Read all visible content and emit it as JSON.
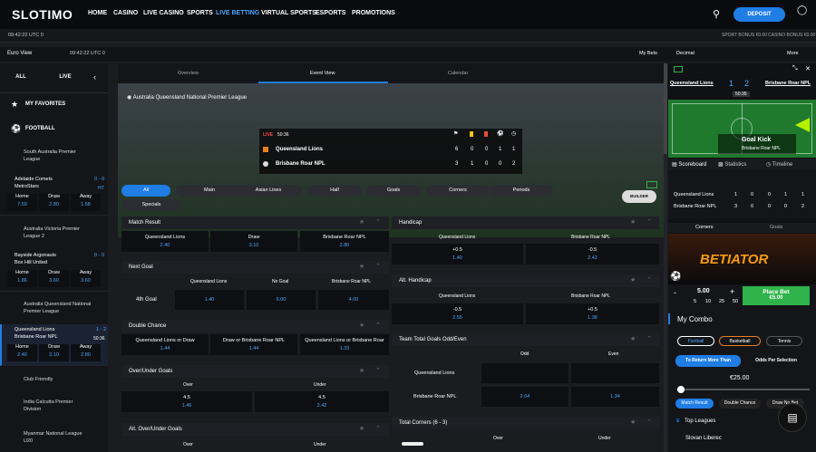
{
  "nav": {
    "logo": "SLOTIMO",
    "items": [
      "HOME",
      "CASINO",
      "LIVE CASINO",
      "SPORTS",
      "LIVE BETTING",
      "VIRTUAL SPORTS",
      "ESPORTS",
      "PROMOTIONS"
    ],
    "deposit": "DEPOSIT",
    "active_color": "#4aa8ff"
  },
  "timebar": {
    "time": "09:42:22 UTC 0",
    "bonus1": "SPORT BONUS €0.00",
    "bonus2": "CASINO BONUS €0.00"
  },
  "toolbar": {
    "view": "Euro View",
    "time": "09:42:22 UTC 0",
    "mybets": "My Bets",
    "decimal": "Decimal",
    "more": "More"
  },
  "left": {
    "tab_all": "ALL",
    "tab_live": "LIVE",
    "favorites": "MY FAVORITES",
    "football": "FOOTBALL",
    "leagues": [
      {
        "name": "South Australia Premier League"
      },
      {
        "name": "Australia Victoria Premier League 2"
      },
      {
        "name": "Australia Queensland National Premier League"
      },
      {
        "name": "Club Friendly"
      },
      {
        "name": "India Calcutta Premier Division"
      },
      {
        "name": "Myanmar National League U20"
      }
    ],
    "matches": [
      {
        "home": "Adelaide Comets",
        "away": "MetroStars",
        "score": "0 - 0",
        "time": "HT",
        "h": "7.50",
        "d": "2.80",
        "a": "1.58"
      },
      {
        "home": "Bayside Argonauts",
        "away": "Box Hill United",
        "score": "0 - 0",
        "time": "",
        "h": "1.86",
        "d": "3.60",
        "a": "3.60"
      },
      {
        "home": "Queensland Lions",
        "away": "Brisbane Roar NPL",
        "score": "1 - 2",
        "time": "50:36",
        "h": "2.40",
        "d": "3.10",
        "a": "2.80"
      }
    ],
    "lbl_home": "Home",
    "lbl_draw": "Draw",
    "lbl_away": "Away"
  },
  "center": {
    "tabs": [
      "Overview",
      "Event View",
      "Calendar"
    ],
    "league": "Australia Queensland National Premier League",
    "live": "LIVE",
    "clock": "50:36",
    "team1": {
      "name": "Queensland Lions",
      "stats": [
        "6",
        "0",
        "0",
        "1",
        "1"
      ]
    },
    "team2": {
      "name": "Brisbane Roar NPL",
      "stats": [
        "3",
        "1",
        "0",
        "0",
        "2"
      ]
    },
    "pills": [
      "All",
      "Main",
      "Asian Lines",
      "Half",
      "Goals",
      "Corners",
      "Periods",
      "Specials"
    ],
    "builder": "BUILDER",
    "match_result": {
      "title": "Match Result",
      "opts": [
        {
          "l": "Queensland Lions",
          "o": "2.40"
        },
        {
          "l": "Draw",
          "o": "3.10"
        },
        {
          "l": "Brisbane Roar NPL",
          "o": "2.80"
        }
      ]
    },
    "next_goal": {
      "title": "Next Goal",
      "h1": "Queensland Lions",
      "h2": "No Goal",
      "h3": "Brisbane Roar NPL",
      "row": "4th Goal",
      "o": [
        "1.40",
        "6.00",
        "4.00"
      ]
    },
    "double_chance": {
      "title": "Double Chance",
      "opts": [
        {
          "l": "Queensland Lions or Draw",
          "o": "1.44"
        },
        {
          "l": "Draw or Brisbane Roar NPL",
          "o": "1.44"
        },
        {
          "l": "Queensland Lions or Brisbane Roar",
          "o": "1.33"
        }
      ]
    },
    "ou": {
      "title": "Over/Under Goals",
      "over": "Over",
      "under": "Under",
      "l1": "4.5",
      "o1": "1.46",
      "l2": "4.5",
      "o2": "2.42"
    },
    "alt_ou": {
      "title": "Alt. Over/Under Goals",
      "over": "Over",
      "under": "Under"
    },
    "handicap": {
      "title": "Handicap",
      "h1": "Queensland Lions",
      "h2": "Brisbane Roar NPL",
      "l1": "+0.5",
      "o1": "1.40",
      "l2": "-0.5",
      "o2": "2.42"
    },
    "alt_handicap": {
      "title": "Alt. Handicap",
      "h1": "Queensland Lions",
      "h2": "Brisbane Roar NPL",
      "l1": "-0.5",
      "o1": "2.55",
      "l2": "+0.5",
      "o2": "1.38"
    },
    "ttg": {
      "title": "Team Total Goals Odd/Even",
      "odd": "Odd",
      "even": "Even",
      "t1": "Queensland Lions",
      "t2": "Brisbane Roar NPL",
      "o1": "2.64",
      "o2": "1.34"
    },
    "corners": {
      "title": "Total Corners",
      "range": "(6 - 3)",
      "over": "Over",
      "under": "Under"
    }
  },
  "right": {
    "team1": "Queensland Lions",
    "team2": "Brisbane Roar NPL",
    "s1": "1",
    "s2": "2",
    "clock": "50:35",
    "event": "Goal Kick",
    "event_team": "Brisbane Roar NPL",
    "tabs": [
      "Scoreboard",
      "Statistics",
      "Timeline"
    ],
    "stats": [
      {
        "n": "Queensland Lions",
        "v": [
          "1",
          "0",
          "0",
          "1",
          "1"
        ]
      },
      {
        "n": "Brisbane Roar NPL",
        "v": [
          "3",
          "0",
          "0",
          "0",
          "2"
        ]
      }
    ],
    "corners": "Corners",
    "goals": "Goals",
    "ad": "BETIATOR",
    "stake": "5.00",
    "minus": "-",
    "plus": "+",
    "chips": [
      "5",
      "10",
      "25",
      "50"
    ],
    "place": "Place Bet",
    "place_amt": "€5.00",
    "mycombo": "My Combo",
    "sports": [
      "Football",
      "Basketball",
      "Tennis"
    ],
    "return_tab": "To Return More Than",
    "odds_tab": "Odds Per Selection",
    "amount": "€25.00",
    "filters": [
      "Match Result",
      "Double Chance",
      "Draw No Bet"
    ],
    "top_leagues": "Top Leagues",
    "league_item": "Slovan Liberec"
  }
}
